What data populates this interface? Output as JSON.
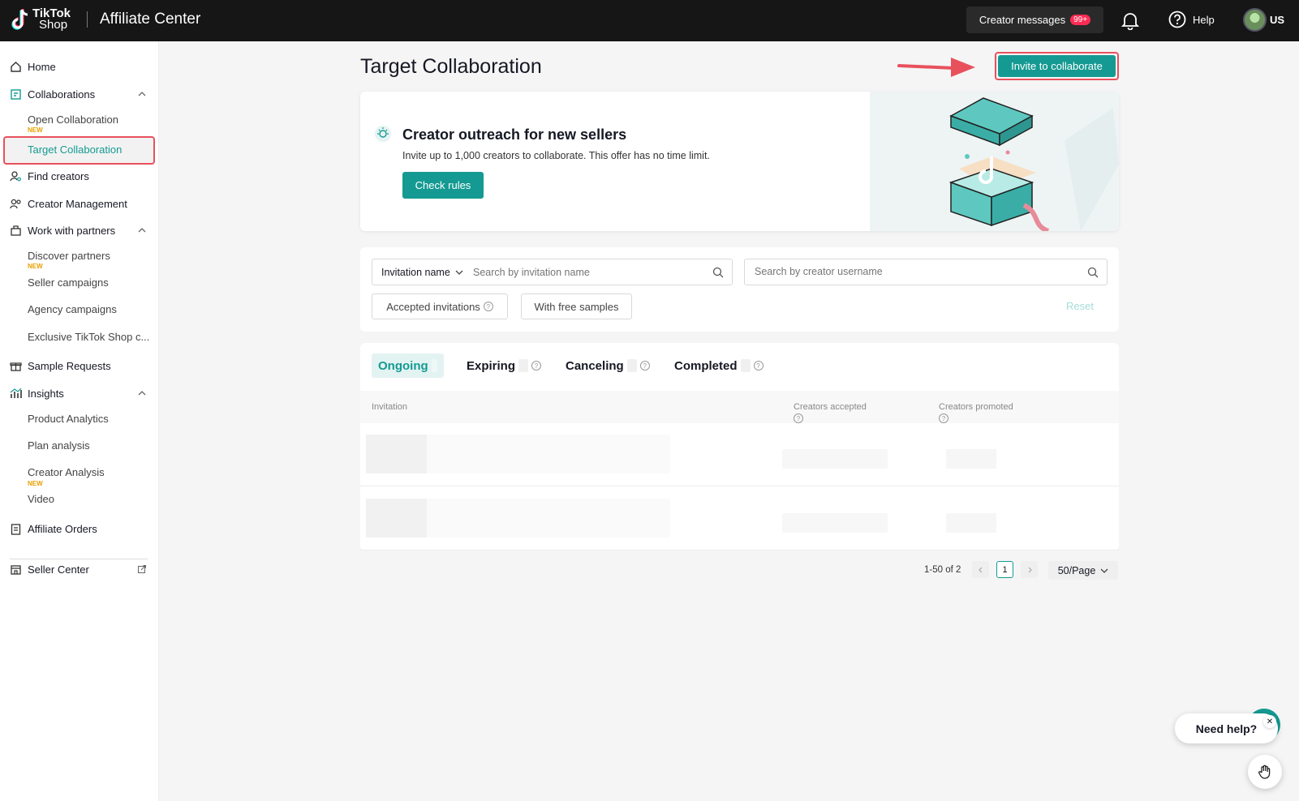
{
  "header": {
    "logo_line1": "TikTok",
    "logo_line2": "Shop",
    "app_title": "Affiliate Center",
    "creator_messages": "Creator messages",
    "creator_messages_badge": "99+",
    "help": "Help",
    "region": "US"
  },
  "sidebar": {
    "home": "Home",
    "collaborations": "Collaborations",
    "open_collaboration": "Open Collaboration",
    "target_collaboration": "Target Collaboration",
    "find_creators": "Find creators",
    "creator_management": "Creator Management",
    "work_with_partners": "Work with partners",
    "discover_partners": "Discover partners",
    "seller_campaigns": "Seller campaigns",
    "agency_campaigns": "Agency campaigns",
    "exclusive": "Exclusive TikTok Shop c...",
    "sample_requests": "Sample Requests",
    "insights": "Insights",
    "product_analytics": "Product Analytics",
    "plan_analysis": "Plan analysis",
    "creator_analysis": "Creator Analysis",
    "video": "Video",
    "affiliate_orders": "Affiliate Orders",
    "seller_center": "Seller Center",
    "new_tag": "NEW"
  },
  "main": {
    "title": "Target Collaboration",
    "invite_button": "Invite to collaborate",
    "banner": {
      "title": "Creator outreach for new sellers",
      "subtitle": "Invite up to 1,000 creators to collaborate. This offer has no time limit.",
      "check_rules": "Check rules"
    },
    "filters": {
      "select_value": "Invitation name",
      "search_placeholder": "Search by invitation name",
      "creator_placeholder": "Search by creator username",
      "accepted_invitations": "Accepted invitations",
      "free_samples": "With free samples",
      "reset": "Reset"
    },
    "tabs": {
      "ongoing": "Ongoing",
      "expiring": "Expiring",
      "canceling": "Canceling",
      "completed": "Completed"
    },
    "table": {
      "col_invitation": "Invitation",
      "col_accepted": "Creators accepted",
      "col_promoted": "Creators promoted"
    },
    "pagination": {
      "range": "1-50 of 2",
      "current_page": "1",
      "per_page": "50/Page"
    }
  },
  "help_widget": {
    "label": "Need help?"
  },
  "colors": {
    "accent": "#149a92",
    "highlight": "#e8515c",
    "topbar": "#161616"
  }
}
